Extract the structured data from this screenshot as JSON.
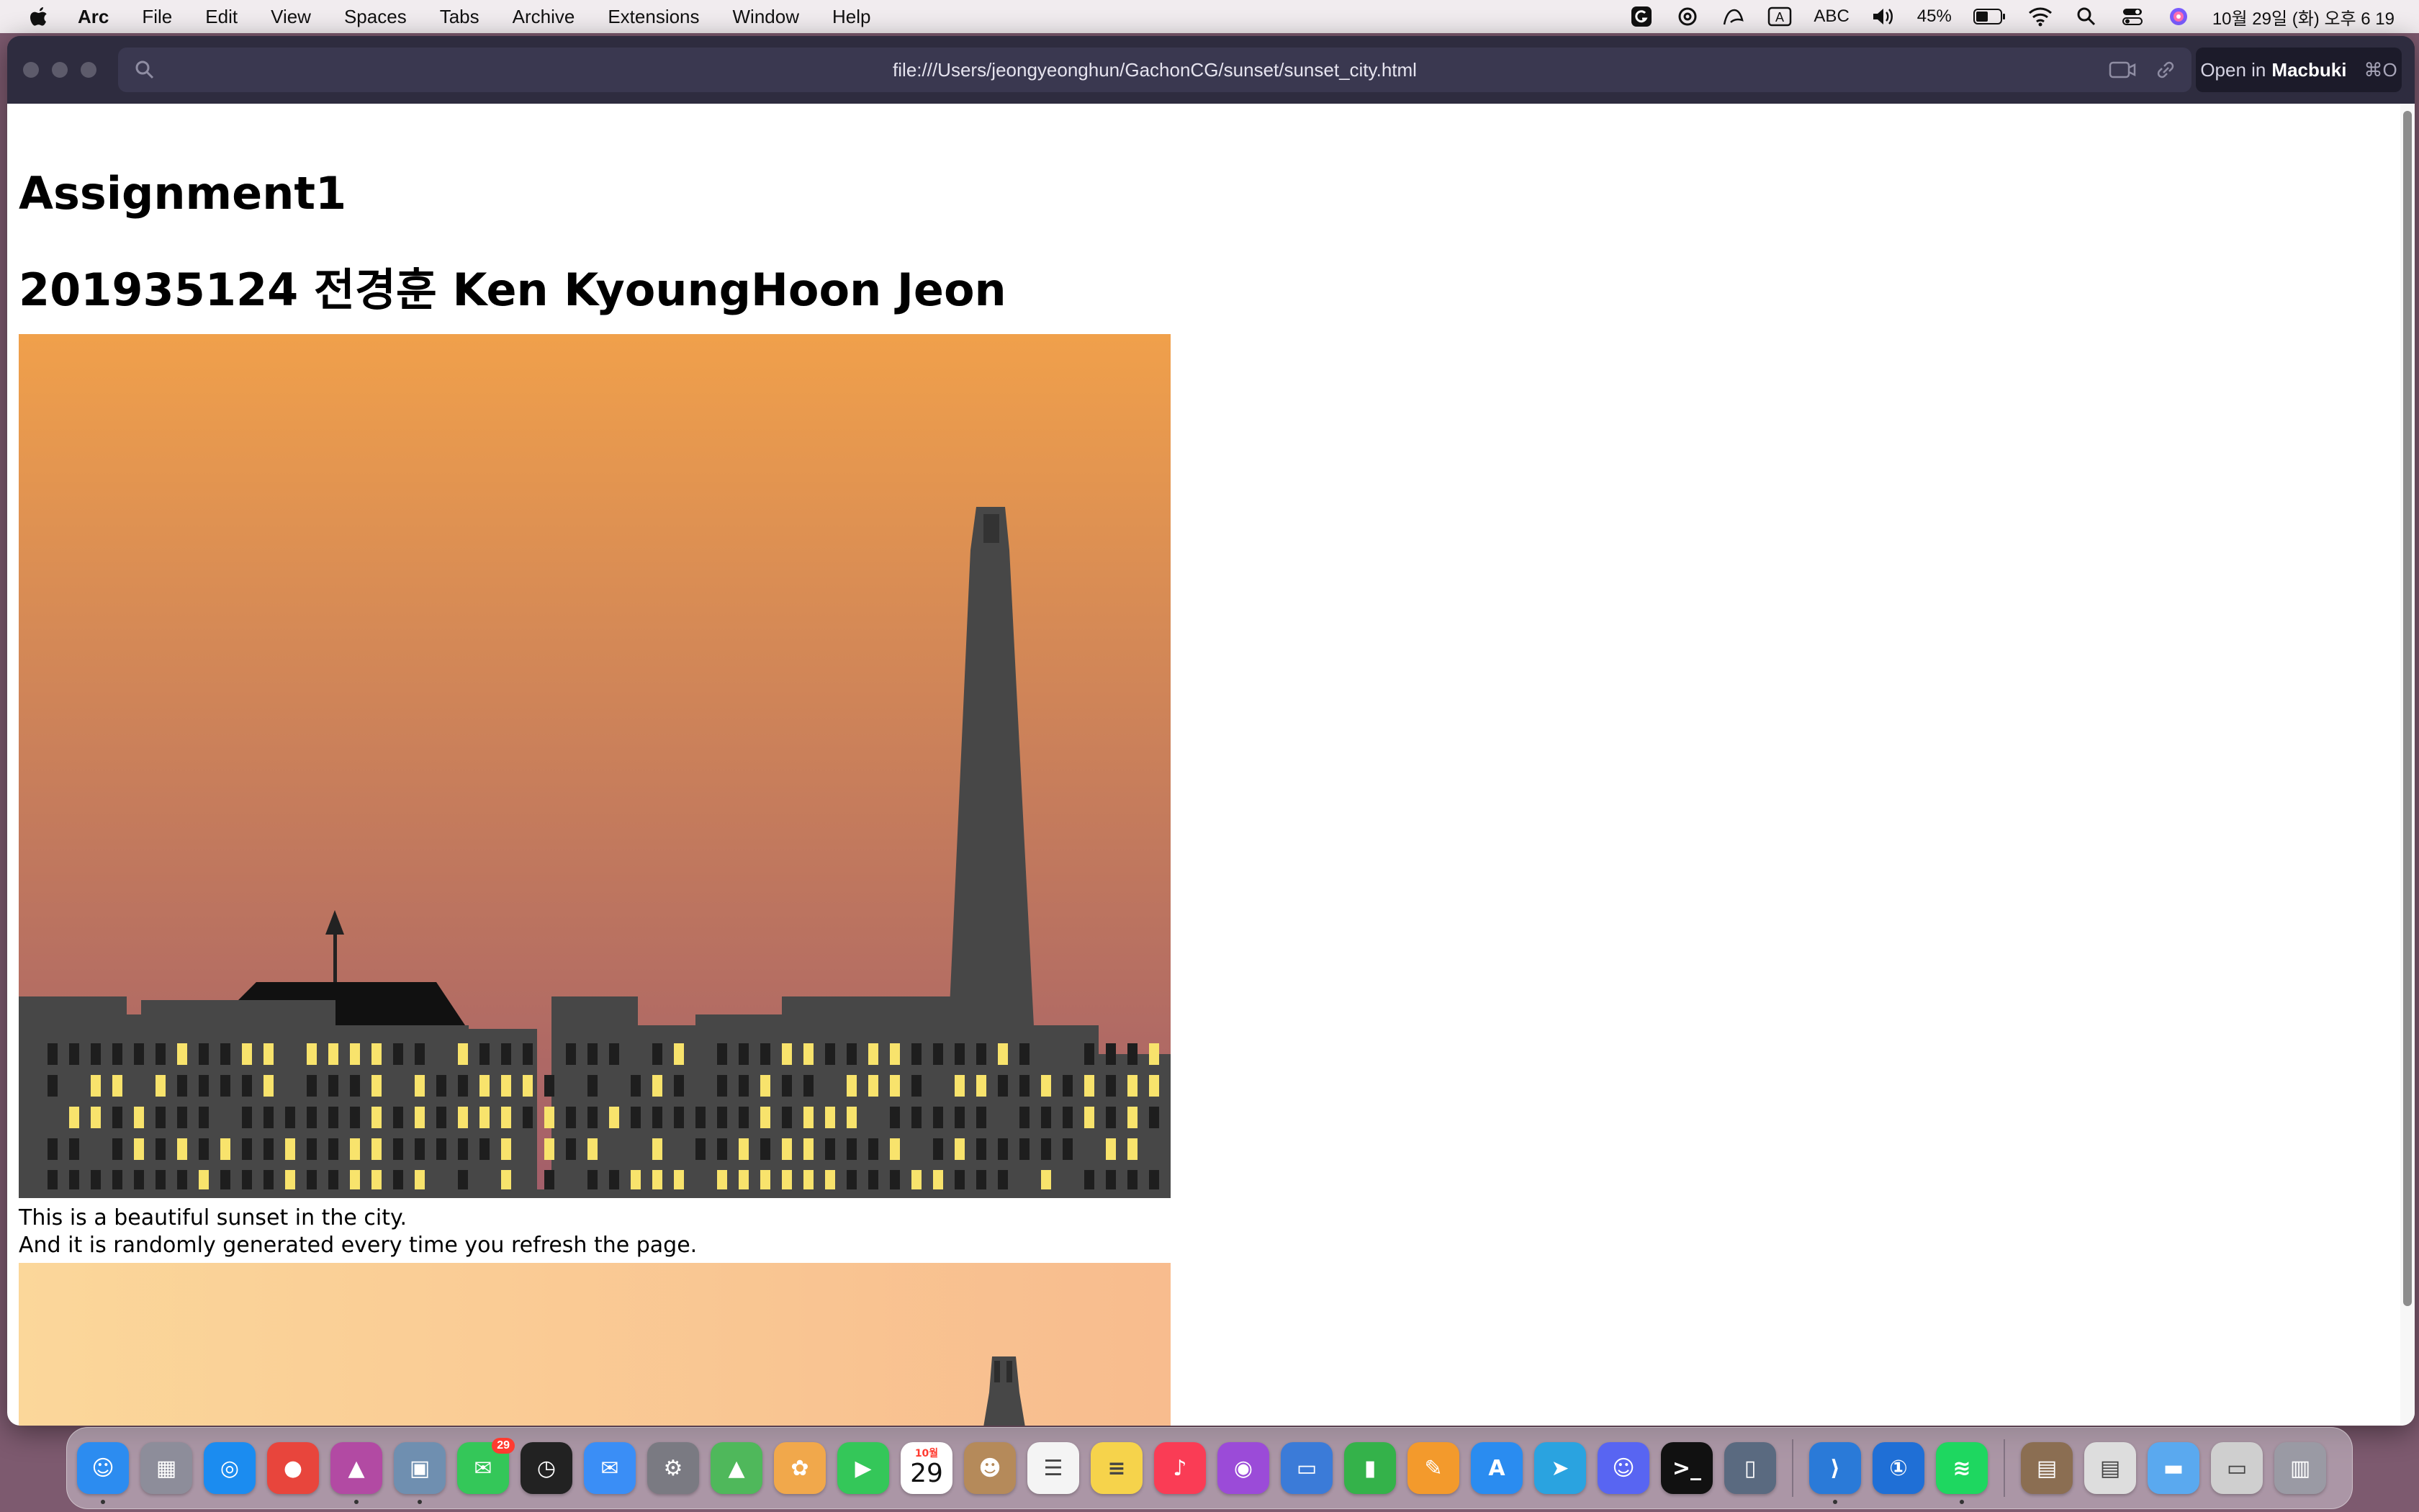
{
  "menubar": {
    "app_name": "Arc",
    "items": [
      "File",
      "Edit",
      "View",
      "Spaces",
      "Tabs",
      "Archive",
      "Extensions",
      "Window",
      "Help"
    ],
    "input_source": "ABC",
    "battery": "45%",
    "datetime": "10월 29일 (화) 오후 6 19"
  },
  "browser": {
    "url": "file:///Users/jeongyeonghun/GachonCG/sunset/sunset_city.html",
    "open_in_prefix": "Open in",
    "open_in_app": "Macbuki",
    "open_in_shortcut": "⌘O"
  },
  "page": {
    "heading1": "Assignment1",
    "heading2": "201935124 전경훈 Ken KyoungHoon Jeon",
    "caption_line1": "This is a beautiful sunset in the city.",
    "caption_line2": "And it is randomly generated every time you refresh the page."
  },
  "scene1": {
    "sky_top": "#f0a04b",
    "sky_bottom": "#a25e6a",
    "building_color": "#474747",
    "window_color": "#f8e36c",
    "roof_color": "#111111"
  },
  "scene2": {
    "sky_top": "#fbd79a",
    "sky_bottom": "#f8bc8e",
    "tower_color": "#474747"
  },
  "dock": {
    "messages_badge": "29",
    "calendar_month": "10월",
    "calendar_day": "29",
    "apps": [
      "finder",
      "launchpad",
      "safari",
      "chrome",
      "affinity",
      "preview",
      "messages",
      "clock",
      "mail",
      "system-settings",
      "maps",
      "photos",
      "facetime",
      "calendar",
      "contacts",
      "reminders",
      "notes",
      "music",
      "podcasts",
      "keynote",
      "numbers",
      "pages",
      "app-store",
      "telegram",
      "discord",
      "terminal",
      "simulator",
      "vscode",
      "1password",
      "spotify",
      "downloads",
      "documents",
      "folder",
      "preview-files",
      "trash"
    ]
  }
}
